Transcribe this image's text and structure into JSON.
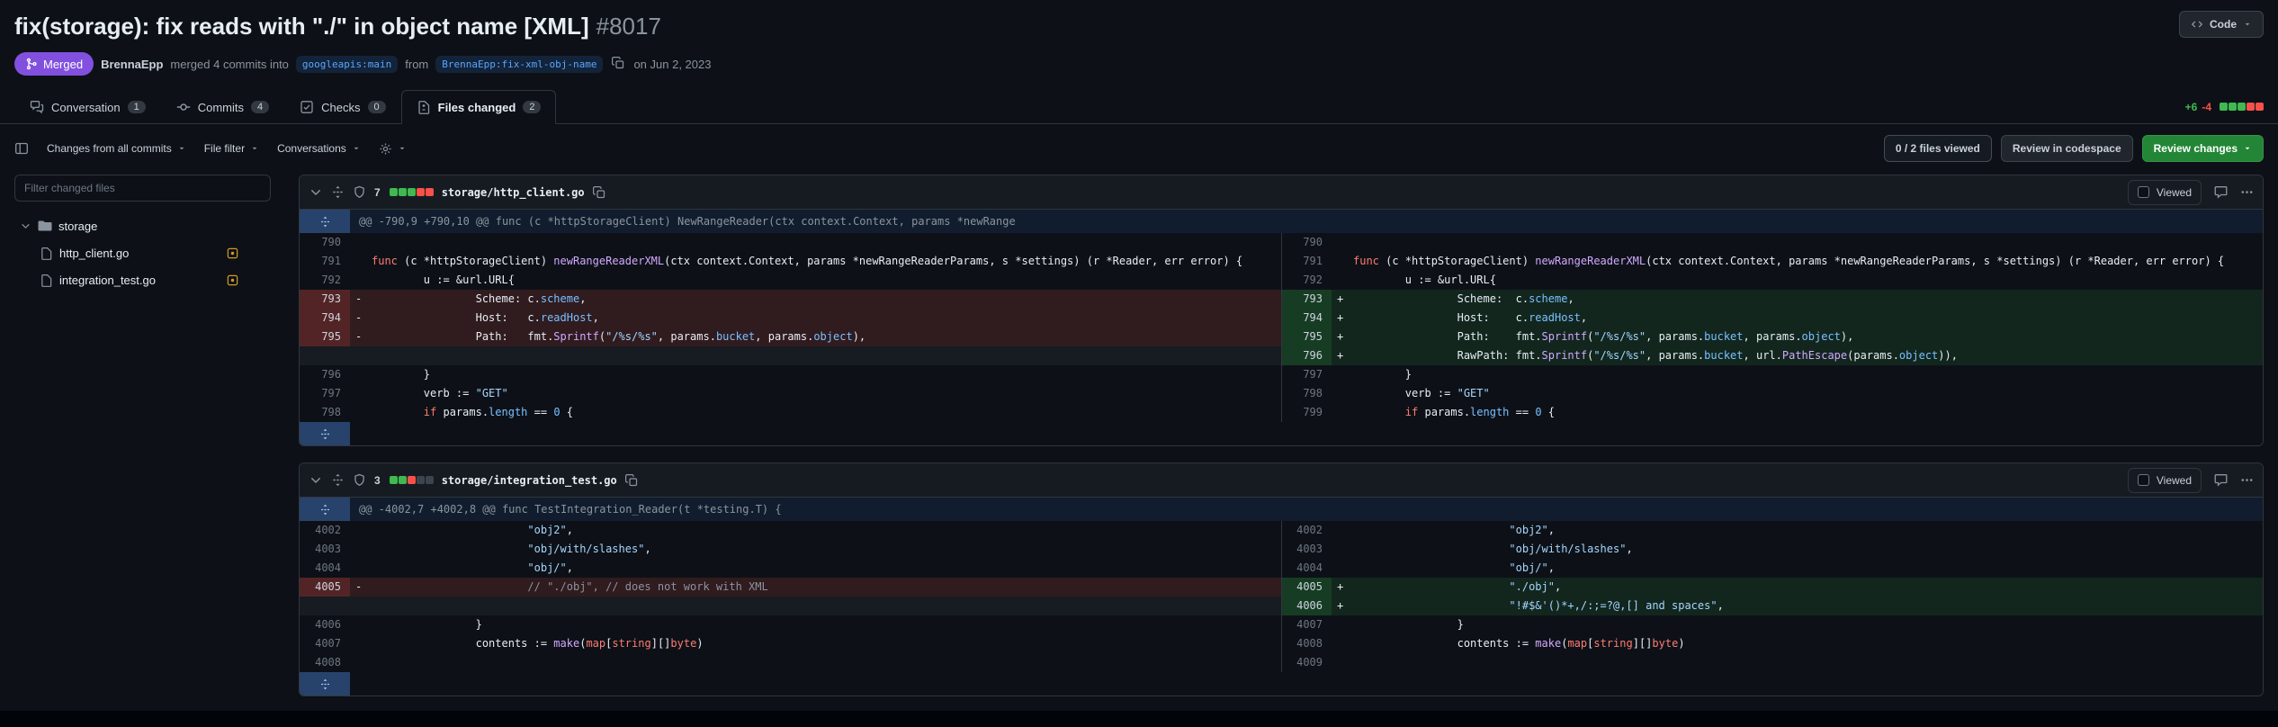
{
  "page": {
    "title": "fix(storage): fix reads with \"./\" in object name [XML]",
    "number": "#8017"
  },
  "header": {
    "code_button": "Code",
    "merged_badge": "Merged",
    "author": "BrennaEpp",
    "merge_text": "merged 4 commits into",
    "base_branch": "googleapis:main",
    "from_text": "from",
    "head_branch": "BrennaEpp:fix-xml-obj-name",
    "merge_date": "on Jun 2, 2023"
  },
  "tabs": [
    {
      "label": "Conversation",
      "count": "1",
      "icon": "comment-discussion",
      "active": false
    },
    {
      "label": "Commits",
      "count": "4",
      "icon": "git-commit",
      "active": false
    },
    {
      "label": "Checks",
      "count": "0",
      "icon": "checklist",
      "active": false
    },
    {
      "label": "Files changed",
      "count": "2",
      "icon": "file-diff",
      "active": true
    }
  ],
  "diffstat": {
    "additions": "+6",
    "deletions": "-4",
    "blocks": [
      "add",
      "add",
      "add",
      "del",
      "del"
    ]
  },
  "toolbar": {
    "changes_from": "Changes from all commits",
    "file_filter": "File filter",
    "conversations": "Conversations",
    "files_viewed": "0 / 2 files viewed",
    "review_codespace": "Review in codespace",
    "review_changes": "Review changes"
  },
  "sidebar": {
    "filter_placeholder": "Filter changed files",
    "folder": "storage",
    "files": [
      {
        "name": "http_client.go",
        "status": "modified"
      },
      {
        "name": "integration_test.go",
        "status": "modified"
      }
    ]
  },
  "files": [
    {
      "path": "storage/http_client.go",
      "changes": "7",
      "blocks": [
        "add",
        "add",
        "add",
        "del",
        "del"
      ],
      "viewed_label": "Viewed",
      "hunk": "@@ -790,9 +790,10 @@ func (c *httpStorageClient) NewRangeReader(ctx context.Context, params *newRange",
      "rows": [
        {
          "l": {
            "n": "790",
            "t": "ctx",
            "s": []
          },
          "r": {
            "n": "790",
            "t": "ctx",
            "s": []
          }
        },
        {
          "l": {
            "n": "791",
            "t": "ctx",
            "s": [
              [
                "k",
                "func"
              ],
              [
                "d",
                " (c *httpStorageClient) "
              ],
              [
                "f",
                "newRangeReaderXML"
              ],
              [
                "d",
                "(ctx context.Context, params *newRangeReaderParams, s *settings) (r *Reader, err error) {"
              ]
            ]
          },
          "r": {
            "n": "791",
            "t": "ctx",
            "s": [
              [
                "k",
                "func"
              ],
              [
                "d",
                " (c *httpStorageClient) "
              ],
              [
                "f",
                "newRangeReaderXML"
              ],
              [
                "d",
                "(ctx context.Context, params *newRangeReaderParams, s *settings) (r *Reader, err error) {"
              ]
            ]
          }
        },
        {
          "l": {
            "n": "792",
            "t": "ctx",
            "s": [
              [
                "d",
                "        u := &url.URL{"
              ]
            ]
          },
          "r": {
            "n": "792",
            "t": "ctx",
            "s": [
              [
                "d",
                "        u := &url.URL{"
              ]
            ]
          }
        },
        {
          "l": {
            "n": "793",
            "t": "del",
            "s": [
              [
                "d",
                "                Scheme: c."
              ],
              [
                "c",
                "scheme"
              ],
              [
                "d",
                ","
              ]
            ]
          },
          "r": {
            "n": "793",
            "t": "add",
            "s": [
              [
                "d",
                "                Scheme:  c."
              ],
              [
                "c",
                "scheme"
              ],
              [
                "d",
                ","
              ]
            ]
          }
        },
        {
          "l": {
            "n": "794",
            "t": "del",
            "s": [
              [
                "d",
                "                Host:   c."
              ],
              [
                "c",
                "readHost"
              ],
              [
                "d",
                ","
              ]
            ]
          },
          "r": {
            "n": "794",
            "t": "add",
            "s": [
              [
                "d",
                "                Host:    c."
              ],
              [
                "c",
                "readHost"
              ],
              [
                "d",
                ","
              ]
            ]
          }
        },
        {
          "l": {
            "n": "795",
            "t": "del",
            "s": [
              [
                "d",
                "                Path:   fmt."
              ],
              [
                "f",
                "Sprintf"
              ],
              [
                "d",
                "("
              ],
              [
                "s",
                "\"/%s/%s\""
              ],
              [
                "d",
                ", params."
              ],
              [
                "c",
                "bucket"
              ],
              [
                "d",
                ", params."
              ],
              [
                "c",
                "object"
              ],
              [
                "d",
                "),"
              ]
            ]
          },
          "r": {
            "n": "795",
            "t": "add",
            "s": [
              [
                "d",
                "                Path:    fmt."
              ],
              [
                "f",
                "Sprintf"
              ],
              [
                "d",
                "("
              ],
              [
                "s",
                "\"/%s/%s\""
              ],
              [
                "d",
                ", params."
              ],
              [
                "c",
                "bucket"
              ],
              [
                "d",
                ", params."
              ],
              [
                "c",
                "object"
              ],
              [
                "d",
                "),"
              ]
            ]
          }
        },
        {
          "l": null,
          "r": {
            "n": "796",
            "t": "add",
            "s": [
              [
                "d",
                "                RawPath: fmt."
              ],
              [
                "f",
                "Sprintf"
              ],
              [
                "d",
                "("
              ],
              [
                "s",
                "\"/%s/%s\""
              ],
              [
                "d",
                ", params."
              ],
              [
                "c",
                "bucket"
              ],
              [
                "d",
                ", url."
              ],
              [
                "f",
                "PathEscape"
              ],
              [
                "d",
                "(params."
              ],
              [
                "c",
                "object"
              ],
              [
                "d",
                ")),"
              ]
            ]
          }
        },
        {
          "l": {
            "n": "796",
            "t": "ctx",
            "s": [
              [
                "d",
                "        }"
              ]
            ]
          },
          "r": {
            "n": "797",
            "t": "ctx",
            "s": [
              [
                "d",
                "        }"
              ]
            ]
          }
        },
        {
          "l": {
            "n": "797",
            "t": "ctx",
            "s": [
              [
                "d",
                "        verb := "
              ],
              [
                "s",
                "\"GET\""
              ]
            ]
          },
          "r": {
            "n": "798",
            "t": "ctx",
            "s": [
              [
                "d",
                "        verb := "
              ],
              [
                "s",
                "\"GET\""
              ]
            ]
          }
        },
        {
          "l": {
            "n": "798",
            "t": "ctx",
            "s": [
              [
                "d",
                "        "
              ],
              [
                "k",
                "if"
              ],
              [
                "d",
                " params."
              ],
              [
                "c",
                "length"
              ],
              [
                "d",
                " == "
              ],
              [
                "c",
                "0"
              ],
              [
                "d",
                " {"
              ]
            ]
          },
          "r": {
            "n": "799",
            "t": "ctx",
            "s": [
              [
                "d",
                "        "
              ],
              [
                "k",
                "if"
              ],
              [
                "d",
                " params."
              ],
              [
                "c",
                "length"
              ],
              [
                "d",
                " == "
              ],
              [
                "c",
                "0"
              ],
              [
                "d",
                " {"
              ]
            ]
          }
        }
      ]
    },
    {
      "path": "storage/integration_test.go",
      "changes": "3",
      "blocks": [
        "add",
        "add",
        "del",
        "neutral",
        "neutral"
      ],
      "viewed_label": "Viewed",
      "hunk": "@@ -4002,7 +4002,8 @@ func TestIntegration_Reader(t *testing.T) {",
      "rows": [
        {
          "l": {
            "n": "4002",
            "t": "ctx",
            "s": [
              [
                "d",
                "                        "
              ],
              [
                "s",
                "\"obj2\""
              ],
              [
                "d",
                ","
              ]
            ]
          },
          "r": {
            "n": "4002",
            "t": "ctx",
            "s": [
              [
                "d",
                "                        "
              ],
              [
                "s",
                "\"obj2\""
              ],
              [
                "d",
                ","
              ]
            ]
          }
        },
        {
          "l": {
            "n": "4003",
            "t": "ctx",
            "s": [
              [
                "d",
                "                        "
              ],
              [
                "s",
                "\"obj/with/slashes\""
              ],
              [
                "d",
                ","
              ]
            ]
          },
          "r": {
            "n": "4003",
            "t": "ctx",
            "s": [
              [
                "d",
                "                        "
              ],
              [
                "s",
                "\"obj/with/slashes\""
              ],
              [
                "d",
                ","
              ]
            ]
          }
        },
        {
          "l": {
            "n": "4004",
            "t": "ctx",
            "s": [
              [
                "d",
                "                        "
              ],
              [
                "s",
                "\"obj/\""
              ],
              [
                "d",
                ","
              ]
            ]
          },
          "r": {
            "n": "4004",
            "t": "ctx",
            "s": [
              [
                "d",
                "                        "
              ],
              [
                "s",
                "\"obj/\""
              ],
              [
                "d",
                ","
              ]
            ]
          }
        },
        {
          "l": {
            "n": "4005",
            "t": "del",
            "s": [
              [
                "m",
                "                        // \"./obj\", // does not work with XML"
              ]
            ]
          },
          "r": {
            "n": "4005",
            "t": "add",
            "s": [
              [
                "d",
                "                        "
              ],
              [
                "s",
                "\"./obj\""
              ],
              [
                "d",
                ","
              ]
            ]
          }
        },
        {
          "l": null,
          "r": {
            "n": "4006",
            "t": "add",
            "s": [
              [
                "d",
                "                        "
              ],
              [
                "s",
                "\"!#$&'()*+,/:;=?@,[] and spaces\""
              ],
              [
                "d",
                ","
              ]
            ]
          }
        },
        {
          "l": {
            "n": "4006",
            "t": "ctx",
            "s": [
              [
                "d",
                "                }"
              ]
            ]
          },
          "r": {
            "n": "4007",
            "t": "ctx",
            "s": [
              [
                "d",
                "                }"
              ]
            ]
          }
        },
        {
          "l": {
            "n": "4007",
            "t": "ctx",
            "s": [
              [
                "d",
                "                contents := "
              ],
              [
                "f",
                "make"
              ],
              [
                "d",
                "("
              ],
              [
                "k",
                "map"
              ],
              [
                "d",
                "["
              ],
              [
                "k",
                "string"
              ],
              [
                "d",
                "][]"
              ],
              [
                "k",
                "byte"
              ],
              [
                "d",
                ")"
              ]
            ]
          },
          "r": {
            "n": "4008",
            "t": "ctx",
            "s": [
              [
                "d",
                "                contents := "
              ],
              [
                "f",
                "make"
              ],
              [
                "d",
                "("
              ],
              [
                "k",
                "map"
              ],
              [
                "d",
                "["
              ],
              [
                "k",
                "string"
              ],
              [
                "d",
                "][]"
              ],
              [
                "k",
                "byte"
              ],
              [
                "d",
                ")"
              ]
            ]
          }
        },
        {
          "l": {
            "n": "4008",
            "t": "ctx",
            "s": []
          },
          "r": {
            "n": "4009",
            "t": "ctx",
            "s": []
          }
        }
      ]
    }
  ]
}
